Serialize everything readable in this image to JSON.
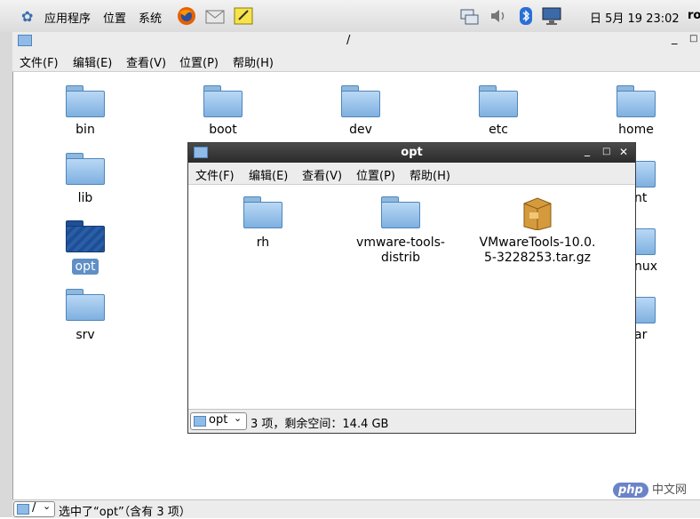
{
  "top_panel": {
    "menus": [
      "应用程序",
      "位置",
      "系统"
    ],
    "clock": "日 5月 19 23:02",
    "user_partial": "ro"
  },
  "main_window": {
    "path": "/",
    "menu": [
      "文件(F)",
      "编辑(E)",
      "查看(V)",
      "位置(P)",
      "帮助(H)"
    ],
    "folders": [
      "bin",
      "boot",
      "dev",
      "etc",
      "home",
      "lib",
      "opt",
      "srv"
    ],
    "partial_labels": [
      "nt",
      "nux",
      "ar"
    ],
    "selected": "opt",
    "status": "选中了“opt”（含有 3 项）",
    "status_location": "/"
  },
  "opt_window": {
    "title": "opt",
    "menu": [
      "文件(F)",
      "编辑(E)",
      "查看(V)",
      "位置(P)",
      "帮助(H)"
    ],
    "items": [
      {
        "name": "rh",
        "type": "folder"
      },
      {
        "name": "vmware-tools-distrib",
        "line1": "vmware-tools-",
        "line2": "distrib",
        "type": "folder"
      },
      {
        "name": "VMwareTools-10.0.5-3228253.tar.gz",
        "line1": "VMwareTools-10.0.",
        "line2": "5-3228253.tar.gz",
        "type": "archive"
      }
    ],
    "location": "opt",
    "status": "3 项，剩余空间：14.4 GB"
  },
  "watermark": {
    "logo": "php",
    "text": "中文网"
  },
  "colors": {
    "folder": "#8fbbe6",
    "selection": "#5f8fc6",
    "titlebar": "#333333"
  }
}
